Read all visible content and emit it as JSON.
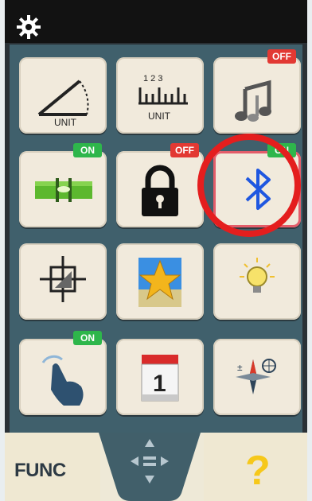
{
  "header": {
    "settings_icon": "gear-icon"
  },
  "tiles": [
    {
      "name": "angle-unit",
      "label": "UNIT",
      "badge": ""
    },
    {
      "name": "length-unit",
      "label": "UNIT",
      "ruler_numbers": "1 2 3",
      "badge": ""
    },
    {
      "name": "sound",
      "badge": "OFF"
    },
    {
      "name": "level",
      "badge": "ON"
    },
    {
      "name": "lock",
      "badge": "OFF"
    },
    {
      "name": "bluetooth",
      "badge": "ON"
    },
    {
      "name": "crosshair-target",
      "badge": ""
    },
    {
      "name": "favorites",
      "badge": ""
    },
    {
      "name": "light",
      "badge": ""
    },
    {
      "name": "touch",
      "badge": "ON"
    },
    {
      "name": "calendar",
      "calendar_day": "1",
      "badge": ""
    },
    {
      "name": "compass-globe",
      "badge": ""
    }
  ],
  "bottom": {
    "func_label": "FUNC",
    "help_label": "?"
  },
  "colors": {
    "on": "#2eb64b",
    "off": "#e23933",
    "highlight": "#e41e1e"
  }
}
